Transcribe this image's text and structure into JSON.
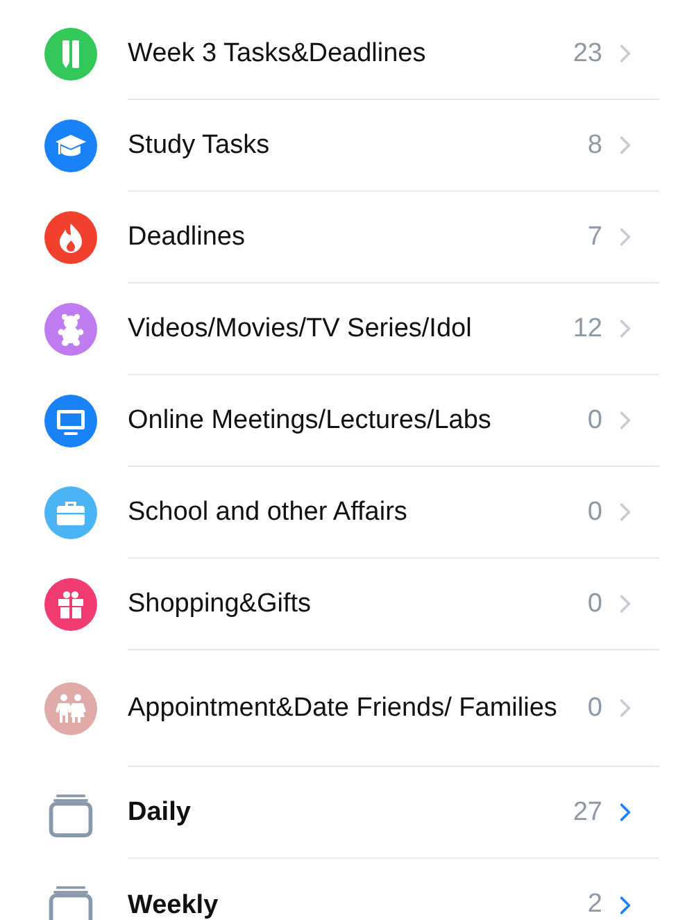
{
  "lists": [
    {
      "kind": "list",
      "name": "Week 3 Tasks&Deadlines",
      "count": "23",
      "color": "#34c759"
    },
    {
      "kind": "list",
      "name": "Study Tasks",
      "count": "8",
      "color": "#1a82f7"
    },
    {
      "kind": "list",
      "name": "Deadlines",
      "count": "7",
      "color": "#f2402f"
    },
    {
      "kind": "list",
      "name": "Videos/Movies/TV Series/Idol",
      "count": "12",
      "color": "#bf7cf0"
    },
    {
      "kind": "list",
      "name": "Online Meetings/Lectures/Labs",
      "count": "0",
      "color": "#1a82f7"
    },
    {
      "kind": "list",
      "name": "School and other Affairs",
      "count": "0",
      "color": "#4ab4f5"
    },
    {
      "kind": "list",
      "name": "Shopping&Gifts",
      "count": "0",
      "color": "#f13c72"
    },
    {
      "kind": "list",
      "name": "Appointment&Date Friends/ Families",
      "count": "0",
      "color": "#dfaaa8"
    },
    {
      "kind": "smart",
      "name": "Daily",
      "count": "27"
    },
    {
      "kind": "smart",
      "name": "Weekly",
      "count": "2"
    }
  ]
}
